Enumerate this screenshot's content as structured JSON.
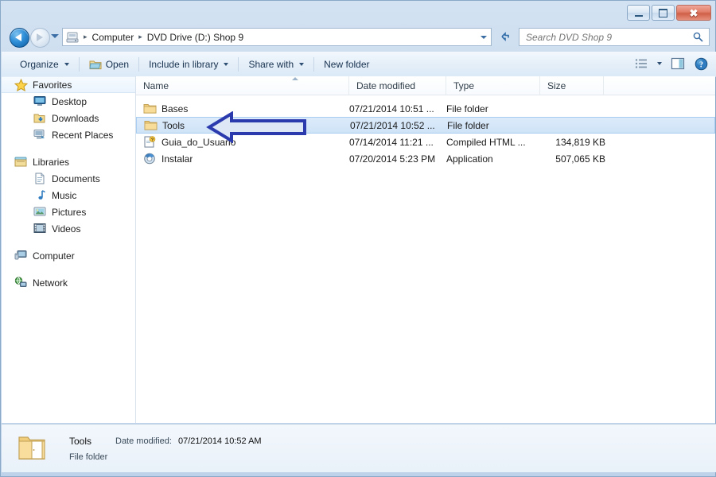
{
  "window": {
    "title": "",
    "controls": {
      "minimize_label": "Minimize",
      "maximize_label": "Maximize",
      "close_label": "Close"
    }
  },
  "address_bar": {
    "back_label": "Back",
    "forward_label": "Forward",
    "recent_label": "Recent pages",
    "crumbs": [
      "Computer",
      "DVD Drive (D:) Shop 9"
    ],
    "separator": "▸",
    "dropdown_label": "Previous locations",
    "refresh_label": "Refresh"
  },
  "search": {
    "placeholder": "Search DVD Shop 9",
    "value": ""
  },
  "toolbar": {
    "organize_label": "Organize",
    "open_label": "Open",
    "include_label": "Include in library",
    "share_label": "Share with",
    "newfolder_label": "New folder",
    "view_label": "Change your view",
    "preview_label": "Show the preview pane",
    "help_label": "Get help"
  },
  "navigation_pane": {
    "groups": [
      {
        "root": {
          "label": "Favorites",
          "icon": "star-icon",
          "hover": true
        },
        "children": [
          {
            "label": "Desktop",
            "icon": "desktop-icon"
          },
          {
            "label": "Downloads",
            "icon": "downloads-icon"
          },
          {
            "label": "Recent Places",
            "icon": "recent-places-icon"
          }
        ]
      },
      {
        "root": {
          "label": "Libraries",
          "icon": "libraries-icon",
          "hover": false
        },
        "children": [
          {
            "label": "Documents",
            "icon": "documents-icon"
          },
          {
            "label": "Music",
            "icon": "music-icon"
          },
          {
            "label": "Pictures",
            "icon": "pictures-icon"
          },
          {
            "label": "Videos",
            "icon": "videos-icon"
          }
        ]
      },
      {
        "root": {
          "label": "Computer",
          "icon": "computer-icon",
          "hover": false
        },
        "children": []
      },
      {
        "root": {
          "label": "Network",
          "icon": "network-icon",
          "hover": false
        },
        "children": []
      }
    ]
  },
  "file_list": {
    "columns": [
      {
        "key": "name",
        "label": "Name"
      },
      {
        "key": "date",
        "label": "Date modified"
      },
      {
        "key": "type",
        "label": "Type"
      },
      {
        "key": "size",
        "label": "Size"
      }
    ],
    "sort_column": "Name",
    "sort_direction": "ascending",
    "rows": [
      {
        "name": "Bases",
        "date": "07/21/2014 10:51 ...",
        "type": "File folder",
        "size": "",
        "icon": "folder-icon",
        "selected": false
      },
      {
        "name": "Tools",
        "date": "07/21/2014 10:52 ...",
        "type": "File folder",
        "size": "",
        "icon": "folder-icon",
        "selected": true
      },
      {
        "name": "Guia_do_Usuario",
        "date": "07/14/2014 11:21 ...",
        "type": "Compiled HTML ...",
        "size": "134,819 KB",
        "icon": "chm-help-icon",
        "selected": false
      },
      {
        "name": "Instalar",
        "date": "07/20/2014 5:23 PM",
        "type": "Application",
        "size": "507,065 KB",
        "icon": "application-icon",
        "selected": false
      }
    ]
  },
  "details_pane": {
    "icon": "folder-large-icon",
    "name": "Tools",
    "date_label": "Date modified:",
    "date_value": "07/21/2014 10:52 AM",
    "type": "File folder"
  },
  "annotation": {
    "shape": "left-arrow",
    "outline_color": "#2b3bae",
    "fill_color": "#dbe6f5",
    "points_at": "Tools"
  },
  "colors": {
    "frame": "#bed3ea",
    "selection_fill": "#cfe3f7",
    "selection_border": "#a8cdf0",
    "close_button": "#cf5f47",
    "folder_yellow": "#f5d98c",
    "accent_blue": "#2f8fd8"
  }
}
